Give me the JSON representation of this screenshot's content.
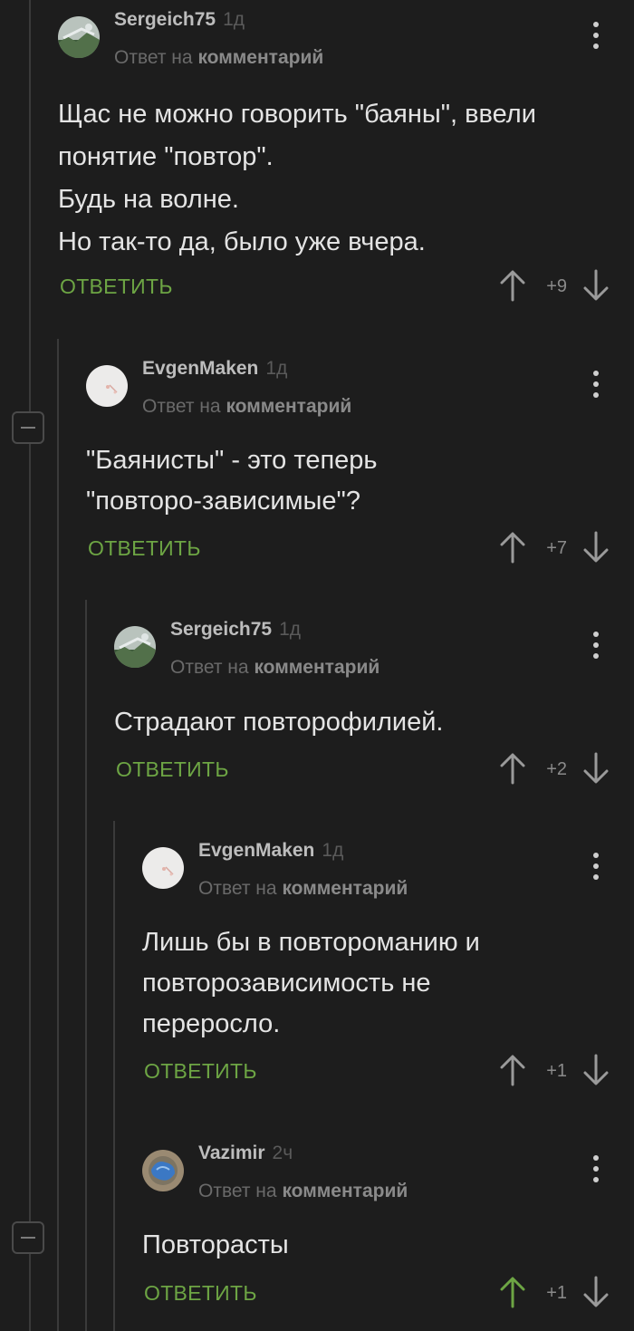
{
  "reply_prefix": "Ответ на",
  "reply_link": "комментарий",
  "reply_label": "ОТВЕТИТЬ",
  "collapse_symbol": "—",
  "colors": {
    "background": "#1d1d1d",
    "accent_green": "#6da544",
    "thread_line": "#3a3a3a",
    "text": "#e4e4e4"
  },
  "comments": [
    {
      "username": "Sergeich75",
      "time": "1д",
      "text_lines": [
        "Щас не можно говорить \"баяны\", ввели понятие \"повтор\".",
        "Будь на волне.",
        "Но так-то да, было уже вчера."
      ],
      "rating": "+9",
      "upvoted": false,
      "avatar": "landscape-avatar"
    },
    {
      "username": "EvgenMaken",
      "time": "1д",
      "text_lines": [
        "\"Баянисты\" - это теперь \"повторо-зависимые\"?"
      ],
      "rating": "+7",
      "upvoted": false,
      "avatar": "white-avatar"
    },
    {
      "username": "Sergeich75",
      "time": "1д",
      "text_lines": [
        "Страдают повторофилией."
      ],
      "rating": "+2",
      "upvoted": false,
      "avatar": "landscape-avatar"
    },
    {
      "username": "EvgenMaken",
      "time": "1д",
      "text_lines": [
        "Лишь бы в повтороманию и повторозависимость не переросло."
      ],
      "rating": "+1",
      "upvoted": false,
      "avatar": "white-avatar"
    },
    {
      "username": "Vazimir",
      "time": "2ч",
      "text_lines": [
        "Повторасты"
      ],
      "rating": "+1",
      "upvoted": true,
      "avatar": "blue-avatar"
    }
  ]
}
